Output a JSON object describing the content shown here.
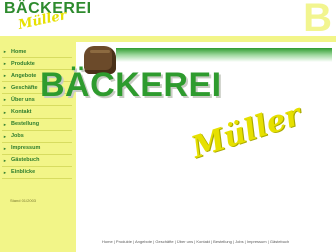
{
  "header": {
    "logo_main": "BÄCKEREI",
    "logo_sub": "Müller",
    "corner_letter": "B"
  },
  "sidebar": {
    "items": [
      {
        "label": "Home"
      },
      {
        "label": "Produkte"
      },
      {
        "label": "Angebote"
      },
      {
        "label": "Geschäfte"
      },
      {
        "label": "Über uns"
      },
      {
        "label": "Kontakt"
      },
      {
        "label": "Bestellung"
      },
      {
        "label": "Jobs"
      },
      {
        "label": "Impressum"
      },
      {
        "label": "Gästebuch"
      },
      {
        "label": "Einblicke"
      }
    ],
    "footer": "Stand 01/2003"
  },
  "main": {
    "title": "BÄCKEREI",
    "subtitle": "Müller"
  },
  "footer_nav": "Home | Produkte | Angebote | Geschäfte | Über uns | Kontakt | Bestellung | Jobs | Impressum | Gästebuch",
  "colors": {
    "brand_green": "#2e9b2e",
    "brand_yellow": "#e6e000",
    "sidebar_bg": "#f2f588"
  }
}
